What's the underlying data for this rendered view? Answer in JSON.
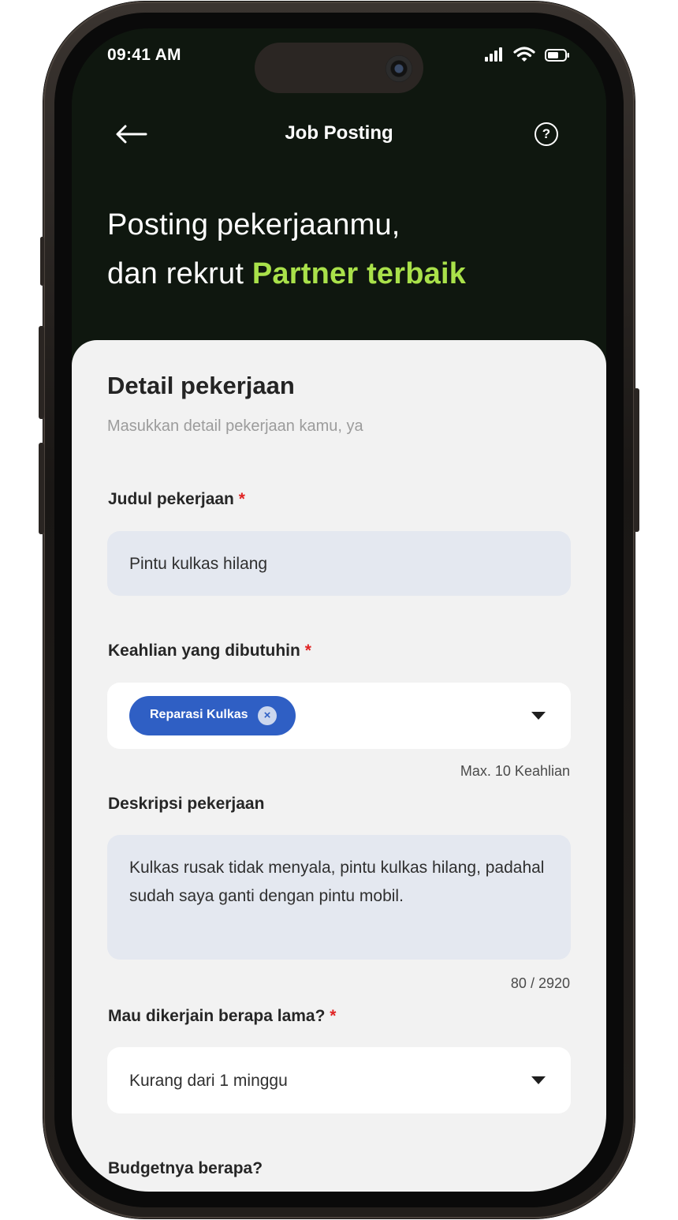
{
  "status_bar": {
    "time": "09:41 AM"
  },
  "nav": {
    "title": "Job Posting",
    "help_symbol": "?"
  },
  "hero": {
    "line1": "Posting pekerjaanmu,",
    "line2_prefix": "dan rekrut ",
    "line2_accent": "Partner terbaik"
  },
  "form": {
    "title": "Detail pekerjaan",
    "subtitle": "Masukkan detail pekerjaan kamu, ya",
    "required_mark": "*",
    "job_title": {
      "label": "Judul pekerjaan",
      "value": "Pintu kulkas hilang"
    },
    "skills": {
      "label": "Keahlian yang dibutuhin",
      "chips": [
        "Reparasi Kulkas"
      ],
      "chip_remove_symbol": "×",
      "helper": "Max. 10 Keahlian"
    },
    "description": {
      "label": "Deskripsi pekerjaan",
      "value": "Kulkas rusak tidak menyala, pintu kulkas hilang, padahal sudah saya ganti dengan pintu mobil.",
      "counter": "80 / 2920"
    },
    "duration": {
      "label": "Mau dikerjain berapa lama?",
      "value": "Kurang dari 1 minggu"
    },
    "budget": {
      "label": "Budgetnya berapa?"
    }
  },
  "colors": {
    "accent": "#a9e14a",
    "chip": "#2f5fc4",
    "required": "#e02424",
    "header_bg": "#0f170f"
  },
  "icons": [
    "back-arrow-icon",
    "help-icon",
    "signal-icon",
    "wifi-icon",
    "battery-icon",
    "dropdown-caret-icon",
    "chip-remove-icon"
  ]
}
